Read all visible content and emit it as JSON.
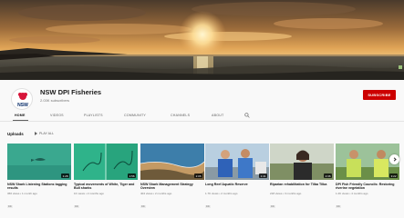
{
  "channel": {
    "name": "NSW DPI Fisheries",
    "subscribers": "2.03K subscribers",
    "subscribe_label": "SUBSCRIBE",
    "logo_text": "NSW",
    "logo_icon": "nsw-waratah-logo"
  },
  "tabs": [
    {
      "label": "HOME",
      "active": true
    },
    {
      "label": "VIDEOS",
      "active": false
    },
    {
      "label": "PLAYLISTS",
      "active": false
    },
    {
      "label": "COMMUNITY",
      "active": false
    },
    {
      "label": "CHANNELS",
      "active": false
    },
    {
      "label": "ABOUT",
      "active": false
    }
  ],
  "search_icon": "search-icon",
  "uploads": {
    "title": "Uploads",
    "play_all": "PLAY ALL",
    "videos": [
      {
        "title": "NSW Shark Listening Stations tagging results",
        "meta": "366 views • 1 month ago",
        "duration": "1:28",
        "cc": "CC"
      },
      {
        "title": "Typical movements of White, Tiger and Bull sharks",
        "meta": "1K views • 2 months ago",
        "duration": "1:56",
        "cc": "CC"
      },
      {
        "title": "NSW Shark Management Strategy Overview",
        "meta": "404 views • 2 months ago",
        "duration": "2:06",
        "cc": "CC"
      },
      {
        "title": "Long Reef Aquatic Reserve",
        "meta": "1.7K views • 2 months ago",
        "duration": "1:41",
        "cc": "CC"
      },
      {
        "title": "Riparian rehabilitation for Tilba Tilba",
        "meta": "218 views • 3 months ago",
        "duration": "2:36",
        "cc": "CC"
      },
      {
        "title": "DPI Fish Friendly Councils: Restoring riverine vegetation",
        "meta": "1.2K views • 4 months ago",
        "duration": "3:22",
        "cc": "CC"
      }
    ]
  },
  "colors": {
    "subscribe": "#cc0000",
    "logo_red": "#d7153a",
    "logo_blue": "#002664"
  }
}
